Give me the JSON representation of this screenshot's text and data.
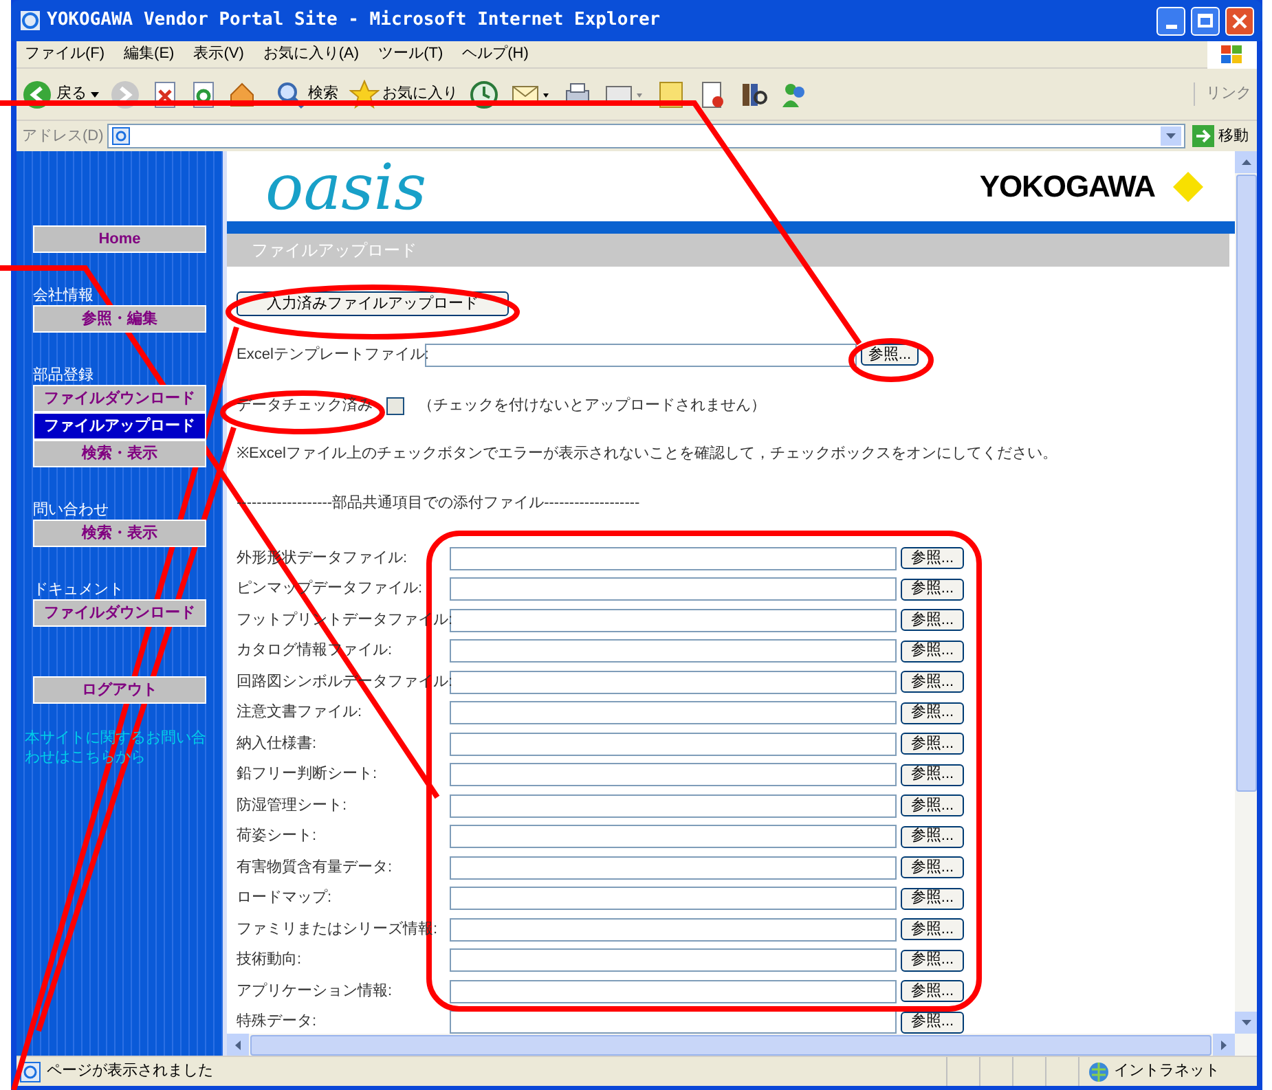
{
  "window": {
    "title": "YOKOGAWA Vendor Portal Site - Microsoft Internet Explorer"
  },
  "menu": [
    "ファイル(F)",
    "編集(E)",
    "表示(V)",
    "お気に入り(A)",
    "ツール(T)",
    "ヘルプ(H)"
  ],
  "toolbar": {
    "back": "戻る",
    "search": "検索",
    "favorites": "お気に入り",
    "links": "リンク"
  },
  "address_bar": {
    "label": "アドレス(D)",
    "go": "移動"
  },
  "sidebar": [
    {
      "kind": "button",
      "label": "Home",
      "selected": false
    },
    {
      "kind": "heading",
      "label": "会社情報"
    },
    {
      "kind": "button",
      "label": "参照・編集",
      "selected": false
    },
    {
      "kind": "heading",
      "label": "部品登録"
    },
    {
      "kind": "button",
      "label": "ファイルダウンロード",
      "selected": false
    },
    {
      "kind": "button",
      "label": "ファイルアップロード",
      "selected": true
    },
    {
      "kind": "button",
      "label": "検索・表示",
      "selected": false
    },
    {
      "kind": "heading",
      "label": "問い合わせ"
    },
    {
      "kind": "button",
      "label": "検索・表示",
      "selected": false
    },
    {
      "kind": "heading",
      "label": "ドキュメント"
    },
    {
      "kind": "button",
      "label": "ファイルダウンロード",
      "selected": false
    },
    {
      "kind": "button",
      "label": "ログアウト",
      "selected": false
    },
    {
      "kind": "link",
      "label": "本サイトに関するお問い合わせはこちらから"
    }
  ],
  "header": {
    "logo": "oasis",
    "brand": "YOKOGAWA",
    "page_title": "ファイルアップロード"
  },
  "upload_button": "入力済みファイルアップロード",
  "template_field": {
    "label": "Excelテンプレートファイル:",
    "button": "参照..."
  },
  "data_check": {
    "label": "データチェック済み",
    "checked": false,
    "note": "（チェックを付けないとアップロードされません）"
  },
  "notice": "※Excelファイル上のチェックボタンでエラーが表示されないことを確認して，チェックボックスをオンにしてください。",
  "section_heading": "-------------------部品共通項目での添付ファイル-------------------",
  "attachments": [
    {
      "label": "外形形状データファイル:",
      "button": "参照..."
    },
    {
      "label": "ピンマップデータファイル:",
      "button": "参照..."
    },
    {
      "label": "フットプリントデータファイル:",
      "button": "参照..."
    },
    {
      "label": "カタログ情報ファイル:",
      "button": "参照..."
    },
    {
      "label": "回路図シンボルデータファイル:",
      "button": "参照..."
    },
    {
      "label": "注意文書ファイル:",
      "button": "参照..."
    },
    {
      "label": "納入仕様書:",
      "button": "参照..."
    },
    {
      "label": "鉛フリー判断シート:",
      "button": "参照..."
    },
    {
      "label": "防湿管理シート:",
      "button": "参照..."
    },
    {
      "label": "荷姿シート:",
      "button": "参照..."
    },
    {
      "label": "有害物質含有量データ:",
      "button": "参照..."
    },
    {
      "label": "ロードマップ:",
      "button": "参照..."
    },
    {
      "label": "ファミリまたはシリーズ情報:",
      "button": "参照..."
    },
    {
      "label": "技術動向:",
      "button": "参照..."
    },
    {
      "label": "アプリケーション情報:",
      "button": "参照..."
    },
    {
      "label": "特殊データ:",
      "button": "参照..."
    }
  ],
  "status_bar": {
    "text": "ページが表示されました",
    "zone": "イントラネット"
  }
}
